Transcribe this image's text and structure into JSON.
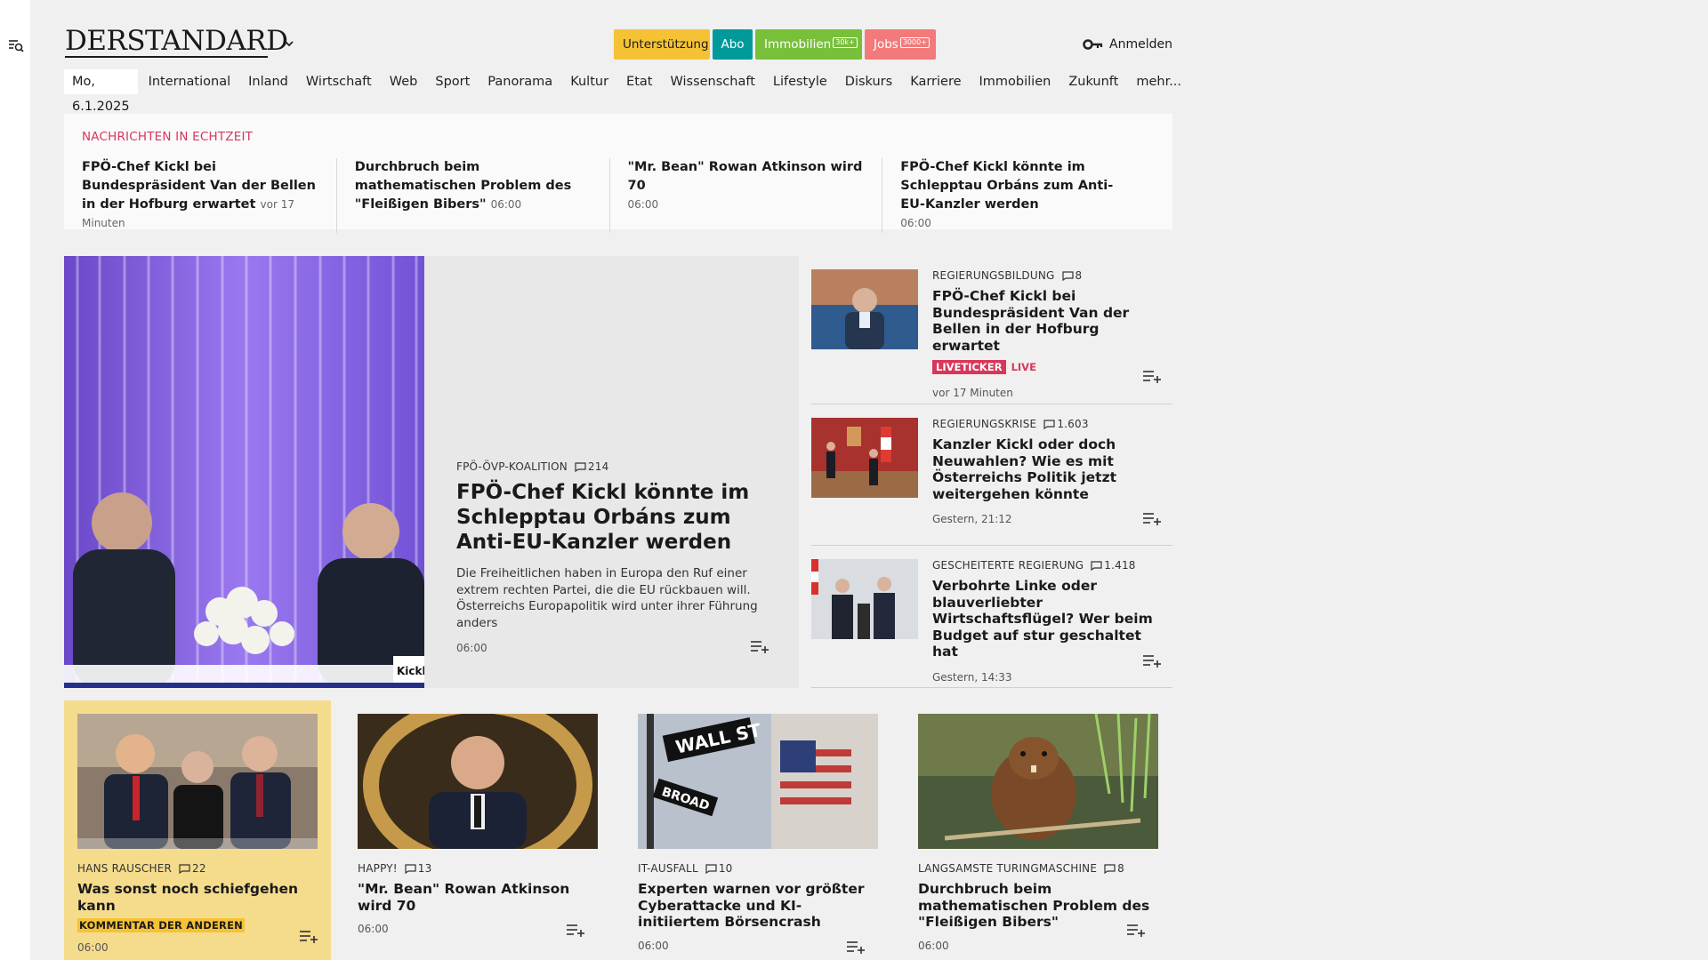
{
  "sidebar": {
    "search_icon": "search-list-icon"
  },
  "header": {
    "logo": "DERSTANDARD",
    "pills": {
      "support": "Unterstützung",
      "abo": "Abo",
      "immobilien": "Immobilien",
      "immobilien_badge": "30k+",
      "jobs": "Jobs",
      "jobs_badge": "3000+"
    },
    "login": "Anmelden"
  },
  "nav": {
    "date": "Mo, 6.1.2025",
    "items": [
      "International",
      "Inland",
      "Wirtschaft",
      "Web",
      "Sport",
      "Panorama",
      "Kultur",
      "Etat",
      "Wissenschaft",
      "Lifestyle",
      "Diskurs",
      "Karriere",
      "Immobilien",
      "Zukunft",
      "mehr..."
    ]
  },
  "breaking": {
    "label": "NACHRICHTEN IN ECHTZEIT",
    "items": [
      {
        "title": "FPÖ-Chef Kickl bei Bundespräsident Van der Bellen in der Hofburg erwar­tet",
        "time": "vor 17 Minuten"
      },
      {
        "title": "Durchbruch beim mathematischen Problem des \"Fleißigen Bibers\"",
        "time": "06:00"
      },
      {
        "title": "\"Mr. Bean\" Rowan Atkinson wird 70",
        "time": "06:00"
      },
      {
        "title": "FPÖ-Chef Kickl könnte im Schlepptau Orbáns zum Anti-EU-Kanzler werden",
        "time": "06:00"
      }
    ]
  },
  "hero": {
    "kicker": "FPÖ-ÖVP-KOALITION",
    "comments": "214",
    "title": "FPÖ-Chef Kickl könnte im Schlepptau Orbáns zum Anti-EU-Kanzler werden",
    "teaser": "Die Freiheitlichen haben in Europa den Ruf einer extrem rechten Partei, die die EU rückbauen will. Österreichs Europapolitik wird unter ihrer Führung anders",
    "time": "06:00",
    "image_label": "Kickl"
  },
  "right_column": [
    {
      "kicker": "REGIERUNGSBILDUNG",
      "comments": "8",
      "title": "FPÖ-Chef Kickl bei Bundespräsi­dent Van der Bellen in der Hofburg erwartet",
      "badge": "LIVETICKER",
      "live": "LIVE",
      "time": "vor 17 Minuten"
    },
    {
      "kicker": "REGIERUNGSKRISE",
      "comments": "1.603",
      "title": "Kanzler Kickl oder doch Neuwahlen? Wie es mit Österreichs Politik jetzt weitergehen könnte",
      "time": "Gestern, 21:12"
    },
    {
      "kicker": "GESCHEITERTE REGIERUNG",
      "comments": "1.418",
      "title": "Verbohrte Linke oder blauverliebter Wirtschaftsflügel? Wer beim Budget auf stur geschaltet hat",
      "time": "Gestern, 14:33"
    }
  ],
  "cards": [
    {
      "kicker": "HANS RAUSCHER",
      "comments": "22",
      "title": "Was sonst noch schiefgehen kann",
      "tag": "KOMMENTAR DER ANDEREN",
      "time": "06:00"
    },
    {
      "kicker": "HAPPY!",
      "comments": "13",
      "title": "\"Mr. Bean\" Rowan Atkinson wird 70",
      "time": "06:00"
    },
    {
      "kicker": "IT-AUSFALL",
      "comments": "10",
      "title": "Experten warnen vor größter Cyberattacke und KI-initiiertem Börsencrash",
      "time": "06:00",
      "sign_1": "WALL ST",
      "sign_2": "BROAD"
    },
    {
      "kicker": "LANGSAMSTE TURINGMASCHINE",
      "comments": "8",
      "title": "Durchbruch beim mathematischen Problem des \"Fleißigen Bibers\"",
      "time": "06:00"
    }
  ],
  "colors": {
    "accent_red": "#d8375a",
    "support_yellow": "#f6c235",
    "abo_teal": "#009a9a",
    "immo_green": "#78bf3a",
    "jobs_pink": "#f27a7a",
    "comment_highlight": "#f5dc8d"
  }
}
